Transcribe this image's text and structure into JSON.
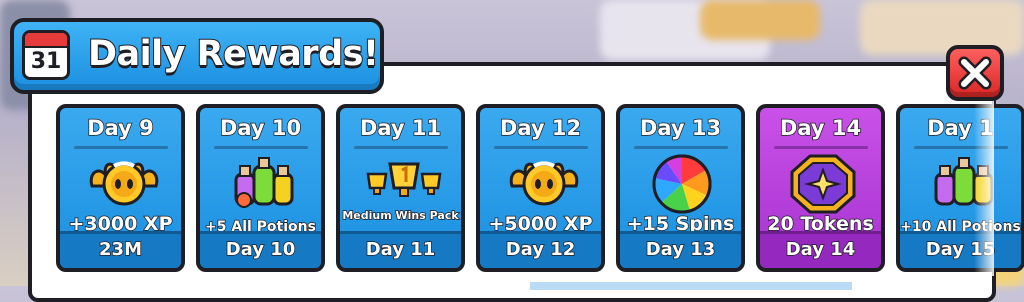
{
  "dialog": {
    "title": "Daily Rewards!",
    "calendar_day": "31",
    "close_icon": "close-icon"
  },
  "rewards": [
    {
      "day": "Day 9",
      "reward": "+3000 XP",
      "footer": "23M",
      "icon": "gold-coin-icon",
      "color": "#2a9ee8"
    },
    {
      "day": "Day 10",
      "reward": "+5 All Potions",
      "footer": "Day 10",
      "icon": "potions-icon",
      "color": "#2a9ee8"
    },
    {
      "day": "Day 11",
      "reward": "Medium Wins Pack",
      "footer": "Day 11",
      "icon": "trophies-icon",
      "color": "#2a9ee8"
    },
    {
      "day": "Day 12",
      "reward": "+5000 XP",
      "footer": "Day 12",
      "icon": "gold-coin-icon",
      "color": "#2a9ee8"
    },
    {
      "day": "Day 13",
      "reward": "+15 Spins",
      "footer": "Day 13",
      "icon": "spin-wheel-icon",
      "color": "#2a9ee8"
    },
    {
      "day": "Day 14",
      "reward": "20 Tokens",
      "footer": "Day 14",
      "icon": "token-icon",
      "color": "#b83fdc"
    },
    {
      "day": "Day 1",
      "reward": "+10 All Potions",
      "footer": "Day 15",
      "icon": "potions-icon",
      "color": "#2a9ee8"
    }
  ]
}
